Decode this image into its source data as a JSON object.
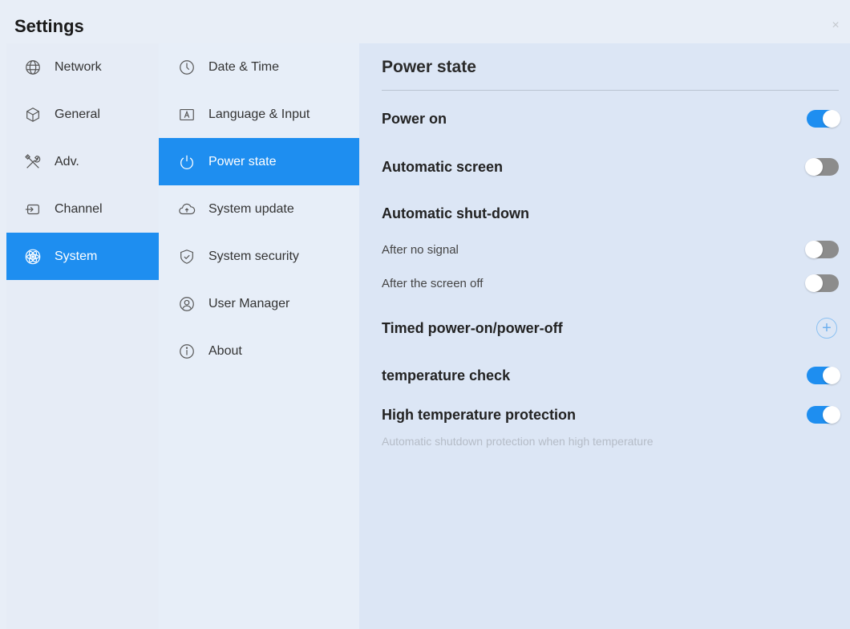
{
  "window": {
    "title": "Settings",
    "close_glyph": "×"
  },
  "sidebar": {
    "items": [
      {
        "label": "Network",
        "icon": "globe-icon"
      },
      {
        "label": "General",
        "icon": "cube-icon"
      },
      {
        "label": "Adv.",
        "icon": "tools-icon"
      },
      {
        "label": "Channel",
        "icon": "input-icon"
      },
      {
        "label": "System",
        "icon": "atom-icon",
        "active": true
      }
    ]
  },
  "submenu": {
    "items": [
      {
        "label": "Date & Time",
        "icon": "clock-icon"
      },
      {
        "label": "Language & Input",
        "icon": "keyboard-a-icon"
      },
      {
        "label": "Power state",
        "icon": "power-icon",
        "active": true
      },
      {
        "label": "System update",
        "icon": "cloud-upload-icon"
      },
      {
        "label": "System security",
        "icon": "shield-icon"
      },
      {
        "label": "User Manager",
        "icon": "user-icon"
      },
      {
        "label": "About",
        "icon": "info-icon"
      }
    ]
  },
  "panel": {
    "title": "Power state",
    "power_on": {
      "label": "Power on",
      "on": true
    },
    "automatic_screen": {
      "label": "Automatic screen",
      "on": false
    },
    "automatic_shutdown": {
      "label": "Automatic shut-down"
    },
    "after_no_signal": {
      "label": "After no signal",
      "on": false
    },
    "after_screen_off": {
      "label": "After the screen off",
      "on": false
    },
    "timed": {
      "label": "Timed power-on/power-off",
      "add_glyph": "+"
    },
    "temperature_check": {
      "label": "temperature check",
      "on": true
    },
    "high_temp": {
      "label": "High temperature protection",
      "on": true,
      "hint": "Automatic shutdown protection when high temperature"
    }
  },
  "colors": {
    "accent": "#1e8ef0",
    "toggle_off": "#8c8c8c",
    "hint": "#b5bcc7"
  }
}
